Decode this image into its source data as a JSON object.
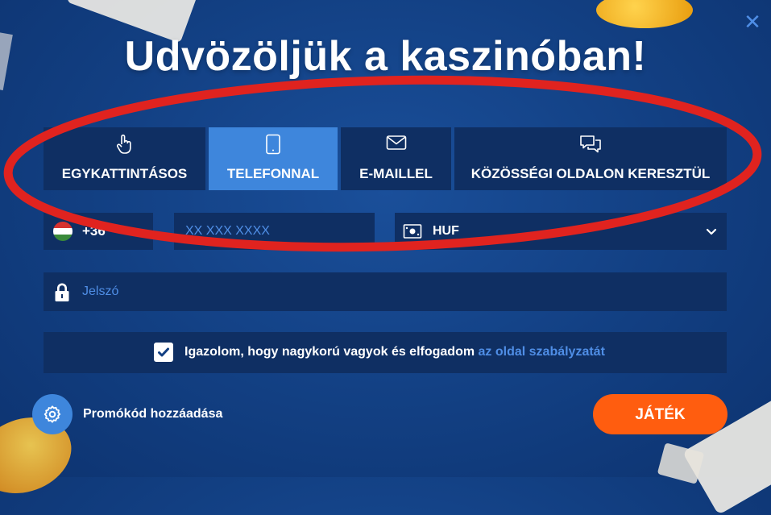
{
  "modal": {
    "title": "Udvözölјük a kaszinóban!",
    "close_glyph": "✕"
  },
  "tabs": [
    {
      "label": "EGYKATTINTÁSOS",
      "icon": "pointer-hand-icon",
      "active": false
    },
    {
      "label": "TELEFONNAL",
      "icon": "smartphone-icon",
      "active": true
    },
    {
      "label": "E-MAILLEL",
      "icon": "envelope-icon",
      "active": false
    },
    {
      "label": "KÖZÖSSÉGI OLDALON KERESZTÜL",
      "icon": "chat-bubbles-icon",
      "active": false
    }
  ],
  "form": {
    "phone_code": "+36",
    "phone_placeholder": "XX XXX XXXX",
    "currency": "HUF",
    "password_placeholder": "Jelszó",
    "terms_text": "Igazolom, hogy nagykorú vagyok és elfogadom ",
    "terms_link": "az oldal szabályzatát",
    "terms_checked": true
  },
  "footer": {
    "promo_label": "Promókód hozzáadása",
    "play_label": "JÁTÉK"
  },
  "colors": {
    "background": "#123f82",
    "field": "#0f2f63",
    "accent": "#3e86dc",
    "link": "#4f8ee6",
    "play": "#ff5d0f",
    "annotation": "#e0231f"
  }
}
